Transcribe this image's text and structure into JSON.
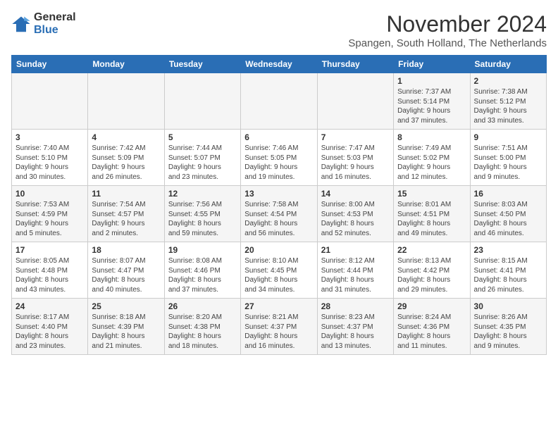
{
  "logo": {
    "general": "General",
    "blue": "Blue"
  },
  "title": "November 2024",
  "location": "Spangen, South Holland, The Netherlands",
  "weekdays": [
    "Sunday",
    "Monday",
    "Tuesday",
    "Wednesday",
    "Thursday",
    "Friday",
    "Saturday"
  ],
  "rows": [
    [
      {
        "day": "",
        "content": ""
      },
      {
        "day": "",
        "content": ""
      },
      {
        "day": "",
        "content": ""
      },
      {
        "day": "",
        "content": ""
      },
      {
        "day": "",
        "content": ""
      },
      {
        "day": "1",
        "content": "Sunrise: 7:37 AM\nSunset: 5:14 PM\nDaylight: 9 hours\nand 37 minutes."
      },
      {
        "day": "2",
        "content": "Sunrise: 7:38 AM\nSunset: 5:12 PM\nDaylight: 9 hours\nand 33 minutes."
      }
    ],
    [
      {
        "day": "3",
        "content": "Sunrise: 7:40 AM\nSunset: 5:10 PM\nDaylight: 9 hours\nand 30 minutes."
      },
      {
        "day": "4",
        "content": "Sunrise: 7:42 AM\nSunset: 5:09 PM\nDaylight: 9 hours\nand 26 minutes."
      },
      {
        "day": "5",
        "content": "Sunrise: 7:44 AM\nSunset: 5:07 PM\nDaylight: 9 hours\nand 23 minutes."
      },
      {
        "day": "6",
        "content": "Sunrise: 7:46 AM\nSunset: 5:05 PM\nDaylight: 9 hours\nand 19 minutes."
      },
      {
        "day": "7",
        "content": "Sunrise: 7:47 AM\nSunset: 5:03 PM\nDaylight: 9 hours\nand 16 minutes."
      },
      {
        "day": "8",
        "content": "Sunrise: 7:49 AM\nSunset: 5:02 PM\nDaylight: 9 hours\nand 12 minutes."
      },
      {
        "day": "9",
        "content": "Sunrise: 7:51 AM\nSunset: 5:00 PM\nDaylight: 9 hours\nand 9 minutes."
      }
    ],
    [
      {
        "day": "10",
        "content": "Sunrise: 7:53 AM\nSunset: 4:59 PM\nDaylight: 9 hours\nand 5 minutes."
      },
      {
        "day": "11",
        "content": "Sunrise: 7:54 AM\nSunset: 4:57 PM\nDaylight: 9 hours\nand 2 minutes."
      },
      {
        "day": "12",
        "content": "Sunrise: 7:56 AM\nSunset: 4:55 PM\nDaylight: 8 hours\nand 59 minutes."
      },
      {
        "day": "13",
        "content": "Sunrise: 7:58 AM\nSunset: 4:54 PM\nDaylight: 8 hours\nand 56 minutes."
      },
      {
        "day": "14",
        "content": "Sunrise: 8:00 AM\nSunset: 4:53 PM\nDaylight: 8 hours\nand 52 minutes."
      },
      {
        "day": "15",
        "content": "Sunrise: 8:01 AM\nSunset: 4:51 PM\nDaylight: 8 hours\nand 49 minutes."
      },
      {
        "day": "16",
        "content": "Sunrise: 8:03 AM\nSunset: 4:50 PM\nDaylight: 8 hours\nand 46 minutes."
      }
    ],
    [
      {
        "day": "17",
        "content": "Sunrise: 8:05 AM\nSunset: 4:48 PM\nDaylight: 8 hours\nand 43 minutes."
      },
      {
        "day": "18",
        "content": "Sunrise: 8:07 AM\nSunset: 4:47 PM\nDaylight: 8 hours\nand 40 minutes."
      },
      {
        "day": "19",
        "content": "Sunrise: 8:08 AM\nSunset: 4:46 PM\nDaylight: 8 hours\nand 37 minutes."
      },
      {
        "day": "20",
        "content": "Sunrise: 8:10 AM\nSunset: 4:45 PM\nDaylight: 8 hours\nand 34 minutes."
      },
      {
        "day": "21",
        "content": "Sunrise: 8:12 AM\nSunset: 4:44 PM\nDaylight: 8 hours\nand 31 minutes."
      },
      {
        "day": "22",
        "content": "Sunrise: 8:13 AM\nSunset: 4:42 PM\nDaylight: 8 hours\nand 29 minutes."
      },
      {
        "day": "23",
        "content": "Sunrise: 8:15 AM\nSunset: 4:41 PM\nDaylight: 8 hours\nand 26 minutes."
      }
    ],
    [
      {
        "day": "24",
        "content": "Sunrise: 8:17 AM\nSunset: 4:40 PM\nDaylight: 8 hours\nand 23 minutes."
      },
      {
        "day": "25",
        "content": "Sunrise: 8:18 AM\nSunset: 4:39 PM\nDaylight: 8 hours\nand 21 minutes."
      },
      {
        "day": "26",
        "content": "Sunrise: 8:20 AM\nSunset: 4:38 PM\nDaylight: 8 hours\nand 18 minutes."
      },
      {
        "day": "27",
        "content": "Sunrise: 8:21 AM\nSunset: 4:37 PM\nDaylight: 8 hours\nand 16 minutes."
      },
      {
        "day": "28",
        "content": "Sunrise: 8:23 AM\nSunset: 4:37 PM\nDaylight: 8 hours\nand 13 minutes."
      },
      {
        "day": "29",
        "content": "Sunrise: 8:24 AM\nSunset: 4:36 PM\nDaylight: 8 hours\nand 11 minutes."
      },
      {
        "day": "30",
        "content": "Sunrise: 8:26 AM\nSunset: 4:35 PM\nDaylight: 8 hours\nand 9 minutes."
      }
    ]
  ]
}
